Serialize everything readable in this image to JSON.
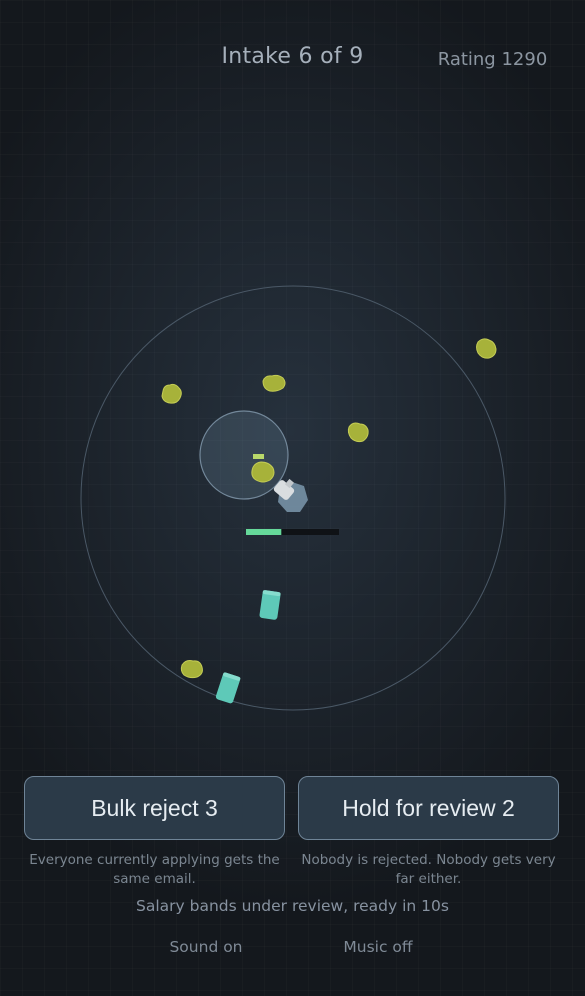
{
  "hud": {
    "intake_label": "Intake 6 of 9",
    "rating_label": "Rating 1290"
  },
  "actions": {
    "bulk_reject": {
      "label": "Bulk reject 3",
      "hint": "Everyone currently applying gets the same email."
    },
    "hold_review": {
      "label": "Hold for review 2",
      "hint": "Nobody is rejected. Nobody gets very far either."
    }
  },
  "status": {
    "message": "Salary bands under review, ready in 10s"
  },
  "settings": {
    "sound_label": "Sound on",
    "music_label": "Music off"
  },
  "game": {
    "player_health": 0.38,
    "applicant_count": 7,
    "offer_count": 2,
    "colors": {
      "applicant": "#a7b23a",
      "offer": "#5ec9b8",
      "player": "#d9dde0",
      "base": "#7b98ad",
      "health_fill": "#66d99a",
      "health_track": "#0f1216"
    }
  }
}
